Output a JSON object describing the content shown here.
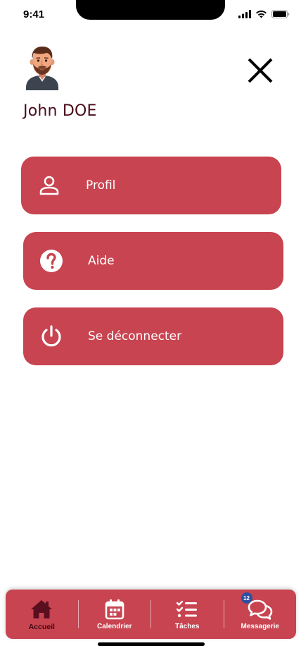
{
  "status_bar": {
    "time": "9:41"
  },
  "header": {
    "user_name": "John DOE",
    "avatar_icon": "avatar-man-beard",
    "close_icon": "close-icon"
  },
  "menu": {
    "items": [
      {
        "label": "Profil",
        "icon": "user-icon"
      },
      {
        "label": "Aide",
        "icon": "help-icon"
      },
      {
        "label": "Se déconnecter",
        "icon": "power-icon"
      }
    ]
  },
  "bottom_nav": {
    "tabs": [
      {
        "label": "Accueil",
        "icon": "home-icon",
        "active": true
      },
      {
        "label": "Calendrier",
        "icon": "calendar-icon",
        "active": false
      },
      {
        "label": "Tâches",
        "icon": "tasks-icon",
        "active": false
      },
      {
        "label": "Messagerie",
        "icon": "chat-icon",
        "active": false,
        "badge": "12"
      }
    ]
  },
  "colors": {
    "accent": "#c84450",
    "name_text": "#4a0b1a",
    "active_tab": "#3d0a14",
    "badge": "#2f4fa0"
  }
}
